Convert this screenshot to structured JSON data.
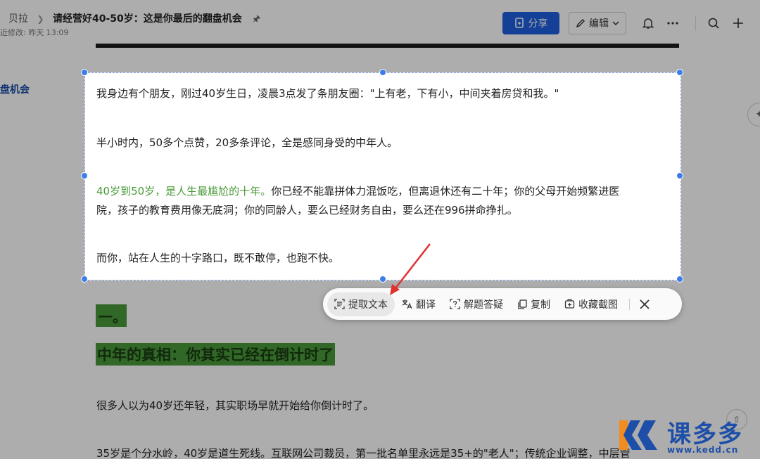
{
  "header": {
    "breadcrumb_root": "贝拉",
    "doc_title": "请经营好40-50岁：这是你最后的翻盘机会",
    "last_modified": "近修改: 昨天 13:09",
    "share_label": "分享",
    "edit_label": "编辑"
  },
  "sidebar": {
    "outline_item": "盘机会"
  },
  "selection": {
    "lines": [
      "我身边有个朋友，刚过40岁生日，凌晨3点发了条朋友圈：\"上有老，下有小，中间夹着房贷和我。\"",
      "半小时内，50多个点赞，20多条评论，全是感同身受的中年人。",
      "你已经不能靠拼体力混饭吃，但离退休还有二十年；你的父母开始频繁进医",
      "院，孩子的教育费用像无底洞；你的同龄人，要么已经财务自由，要么还在996拼命挣扎。",
      "而你，站在人生的十字路口，既不敢停，也跑不快。"
    ],
    "highlight": "40岁到50岁，是人生最尴尬的十年。"
  },
  "toolbar": {
    "items": [
      {
        "label": "提取文本",
        "icon": "scan-text-icon"
      },
      {
        "label": "翻译",
        "icon": "translate-icon"
      },
      {
        "label": "解题答疑",
        "icon": "question-icon"
      },
      {
        "label": "复制",
        "icon": "copy-icon"
      },
      {
        "label": "收藏截图",
        "icon": "bookmark-icon"
      }
    ]
  },
  "document": {
    "section_number": "一。",
    "section_heading": "中年的真相：你其实已经在倒计时了",
    "para1": "很多人以为40岁还年轻，其实职场早就开始给你倒计时了。",
    "para2": "35岁是个分水岭，40岁是道生死线。互联网公司裁员，第一批名单里永远是35+的\"老人\"；传统企业调整，中层管"
  },
  "watermark": {
    "brand": "课多多",
    "url": "www.kedd.cn"
  },
  "colors": {
    "accent": "#1e5fe0",
    "highlight_green": "#4a9a3a",
    "handle": "#3c7de8",
    "arrow": "#e03030"
  }
}
